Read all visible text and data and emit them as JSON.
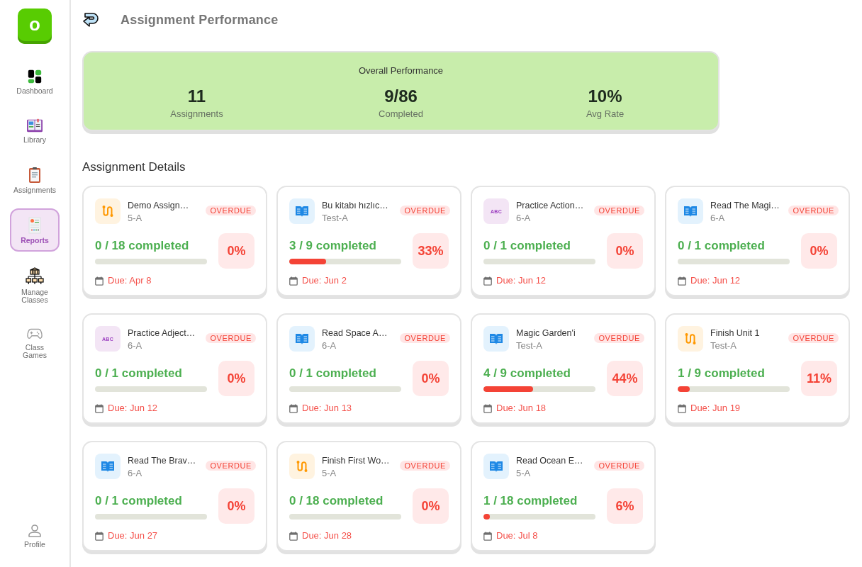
{
  "sidebar": {
    "logo": "o",
    "items": [
      {
        "kind": "dashboard",
        "label": "Dashboard",
        "selected": false
      },
      {
        "kind": "library",
        "label": "Library",
        "selected": false
      },
      {
        "kind": "assignments",
        "label": "Assignments",
        "selected": false
      },
      {
        "kind": "reports",
        "label": "Reports",
        "selected": true
      },
      {
        "kind": "classes",
        "label": "Manage Classes",
        "selected": false
      },
      {
        "kind": "games",
        "label": "Class Games",
        "selected": false
      }
    ],
    "profile": {
      "label": "Profile"
    }
  },
  "header": {
    "title": "Assignment Performance"
  },
  "overall": {
    "title": "Overall Performance",
    "stats": [
      {
        "value": "11",
        "label": "Assignments"
      },
      {
        "value": "9/86",
        "label": "Completed"
      },
      {
        "value": "10%",
        "label": "Avg Rate"
      }
    ]
  },
  "details": {
    "title": "Assignment Details",
    "assignments": [
      {
        "kind": "route",
        "title": "Demo Assign…",
        "class": "5-A",
        "badge": "OVERDUE",
        "overdue": true,
        "progress": "0 / 18 completed",
        "percent": "0%",
        "due": "Due: Apr 8"
      },
      {
        "kind": "book",
        "title": "Bu kitabı hızlıc…",
        "class": "Test-A",
        "badge": "OVERDUE",
        "overdue": true,
        "progress": "3 / 9 completed",
        "level": 0.33,
        "percent": "33%",
        "due": "Due: Jun 2"
      },
      {
        "kind": "letters",
        "icon_text": "ABC",
        "title": "Practice Action…",
        "class": "6-A",
        "badge": "OVERDUE",
        "overdue": true,
        "progress": "0 / 1 completed",
        "percent": "0%",
        "due": "Due: Jun 12"
      },
      {
        "kind": "book",
        "title": "Read The Magi…",
        "class": "6-A",
        "badge": "OVERDUE",
        "overdue": true,
        "progress": "0 / 1 completed",
        "percent": "0%",
        "due": "Due: Jun 12"
      },
      {
        "kind": "letters",
        "icon_text": "ABC",
        "title": "Practice Adject…",
        "class": "6-A",
        "badge": "OVERDUE",
        "overdue": true,
        "progress": "0 / 1 completed",
        "percent": "0%",
        "due": "Due: Jun 12"
      },
      {
        "kind": "book",
        "title": "Read Space A…",
        "class": "6-A",
        "badge": "OVERDUE",
        "overdue": true,
        "progress": "0 / 1 completed",
        "percent": "0%",
        "due": "Due: Jun 13"
      },
      {
        "kind": "book",
        "title": "Magic Garden'i",
        "class": "Test-A",
        "badge": "OVERDUE",
        "overdue": true,
        "progress": "4 / 9 completed",
        "level": 0.44,
        "percent": "44%",
        "due": "Due: Jun 18"
      },
      {
        "kind": "route",
        "title": "Finish Unit 1",
        "class": "Test-A",
        "badge": "OVERDUE",
        "overdue": true,
        "progress": "1 / 9 completed",
        "level": 0.11,
        "percent": "11%",
        "due": "Due: Jun 19"
      },
      {
        "kind": "book",
        "title": "Read The Brav…",
        "class": "6-A",
        "badge": "OVERDUE",
        "overdue": true,
        "progress": "0 / 1 completed",
        "percent": "0%",
        "due": "Due: Jun 27"
      },
      {
        "kind": "route",
        "title": "Finish First Wo…",
        "class": "5-A",
        "badge": "OVERDUE",
        "overdue": true,
        "progress": "0 / 18 completed",
        "percent": "0%",
        "due": "Due: Jun 28"
      },
      {
        "kind": "book",
        "title": "Read Ocean E…",
        "class": "5-A",
        "badge": "OVERDUE",
        "overdue": true,
        "progress": "1 / 18 completed",
        "level": 0.06,
        "percent": "6%",
        "due": "Due: Jul 8"
      }
    ]
  }
}
